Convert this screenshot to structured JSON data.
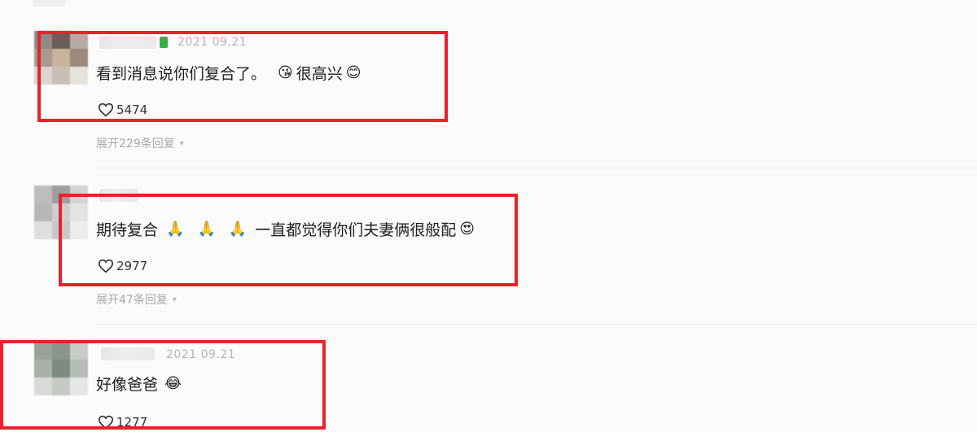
{
  "comments": [
    {
      "time": "2021 09.21",
      "text": "看到消息说你们复合了。",
      "text_suffix": "很高兴",
      "likes": "5474",
      "replies": "展开229条回复"
    },
    {
      "text": "期待复合",
      "text_suffix": "一直都觉得你们夫妻俩很般配",
      "likes": "2977",
      "replies": "展开47条回复"
    },
    {
      "time": "2021 09.21",
      "text": "好像爸爸",
      "likes": "1277"
    }
  ],
  "colors": {
    "highlight": "#e8222b",
    "verified": "#33b24a"
  },
  "icons": [
    "heart-outline-icon",
    "chevron-down-icon",
    "emoji-icon"
  ]
}
